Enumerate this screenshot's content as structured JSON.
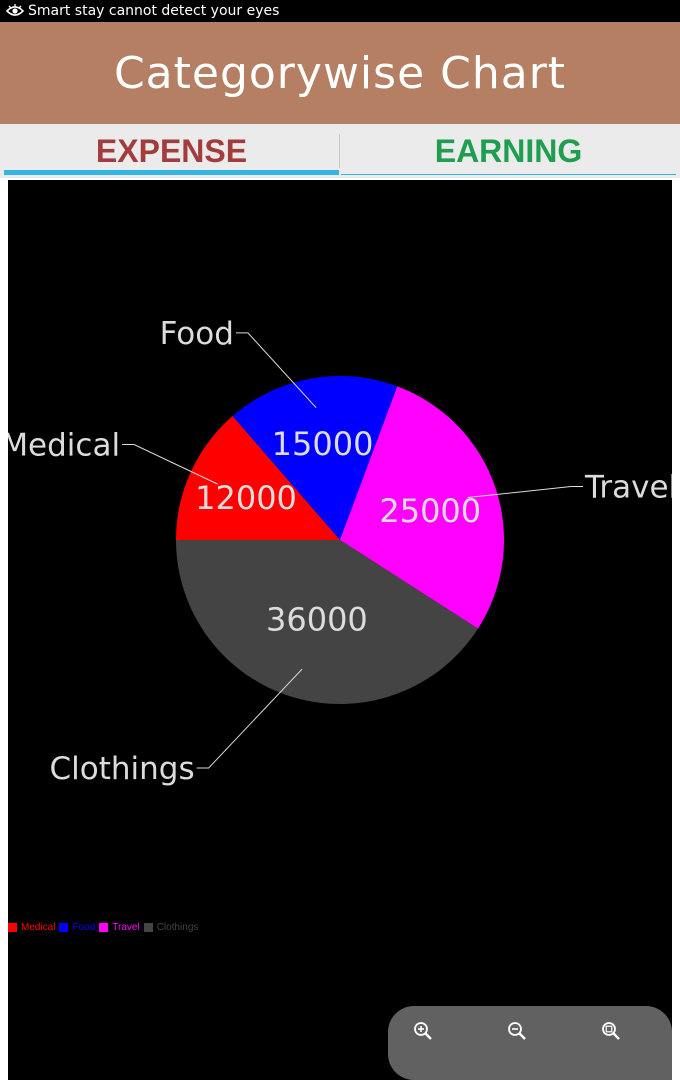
{
  "status_bar": {
    "notification": "Smart stay cannot detect your eyes"
  },
  "header": {
    "title": "Categorywise Chart",
    "background": "#b47f63"
  },
  "tabs": [
    {
      "label": "EXPENSE",
      "color": "#a33d3d",
      "active": true
    },
    {
      "label": "EARNING",
      "color": "#1e9e4e",
      "active": false
    }
  ],
  "colors": {
    "accent": "#33b5e5",
    "chart_bg": "#000000",
    "label_text": "#dcdcdc"
  },
  "chart_data": {
    "type": "pie",
    "slices": [
      {
        "label": "Medical",
        "value": 12000,
        "color": "#ff0000"
      },
      {
        "label": "Food",
        "value": 15000,
        "color": "#0000ff"
      },
      {
        "label": "Travel",
        "value": 25000,
        "color": "#ff00ff"
      },
      {
        "label": "Clothings",
        "value": 36000,
        "color": "#444444"
      }
    ],
    "legend_position": "bottom-left"
  },
  "zoom_controls": [
    {
      "name": "zoom-in-button",
      "icon": "zoom-in-icon"
    },
    {
      "name": "zoom-out-button",
      "icon": "zoom-out-icon"
    },
    {
      "name": "zoom-reset-button",
      "icon": "zoom-fit-icon"
    }
  ]
}
